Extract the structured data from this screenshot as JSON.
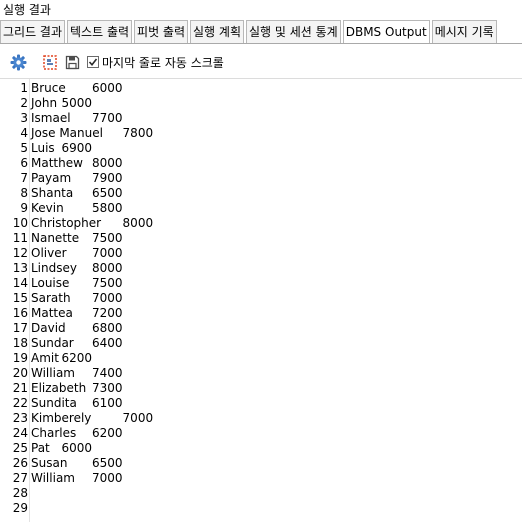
{
  "window": {
    "title": "실행 결과"
  },
  "tabs": [
    {
      "label": "그리드 결과",
      "active": false
    },
    {
      "label": "텍스트 출력",
      "active": false
    },
    {
      "label": "피벗 출력",
      "active": false
    },
    {
      "label": "실행 계획",
      "active": false
    },
    {
      "label": "실행 및 세션 통계",
      "active": false
    },
    {
      "label": "DBMS Output",
      "active": true
    },
    {
      "label": "메시지 기록",
      "active": false
    }
  ],
  "toolbar": {
    "icons": [
      "gear-icon",
      "clear-output-icon",
      "save-icon"
    ],
    "autoscroll_label": "마지막 줄로 자동 스크롤",
    "autoscroll_checked": true
  },
  "output": {
    "lines": [
      {
        "n": "1",
        "text": "Bruce\t6000"
      },
      {
        "n": "2",
        "text": "John\t5000"
      },
      {
        "n": "3",
        "text": "Ismael\t7700"
      },
      {
        "n": "4",
        "text": "Jose Manuel\t7800"
      },
      {
        "n": "5",
        "text": "Luis\t6900"
      },
      {
        "n": "6",
        "text": "Matthew\t8000"
      },
      {
        "n": "7",
        "text": "Payam\t7900"
      },
      {
        "n": "8",
        "text": "Shanta\t6500"
      },
      {
        "n": "9",
        "text": "Kevin\t5800"
      },
      {
        "n": "10",
        "text": "Christopher\t8000"
      },
      {
        "n": "11",
        "text": "Nanette\t7500"
      },
      {
        "n": "12",
        "text": "Oliver\t7000"
      },
      {
        "n": "13",
        "text": "Lindsey\t8000"
      },
      {
        "n": "14",
        "text": "Louise\t7500"
      },
      {
        "n": "15",
        "text": "Sarath\t7000"
      },
      {
        "n": "16",
        "text": "Mattea\t7200"
      },
      {
        "n": "17",
        "text": "David\t6800"
      },
      {
        "n": "18",
        "text": "Sundar\t6400"
      },
      {
        "n": "19",
        "text": "Amit\t6200"
      },
      {
        "n": "20",
        "text": "William\t7400"
      },
      {
        "n": "21",
        "text": "Elizabeth\t7300"
      },
      {
        "n": "22",
        "text": "Sundita\t6100"
      },
      {
        "n": "23",
        "text": "Kimberely\t7000"
      },
      {
        "n": "24",
        "text": "Charles\t6200"
      },
      {
        "n": "25",
        "text": "Pat\t6000"
      },
      {
        "n": "26",
        "text": "Susan\t6500"
      },
      {
        "n": "27",
        "text": "William\t7000"
      },
      {
        "n": "28",
        "text": ""
      },
      {
        "n": "29",
        "text": ""
      }
    ]
  }
}
